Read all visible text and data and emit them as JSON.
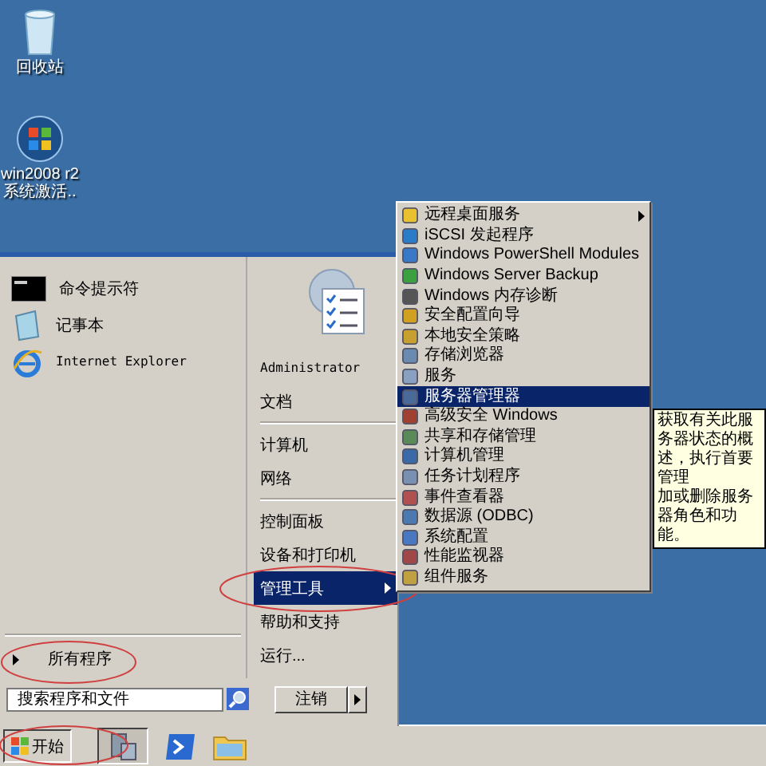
{
  "desktop_icons": [
    {
      "lines": [
        "回收站"
      ]
    },
    {
      "lines": [
        "win2008 r2",
        "系统激活.."
      ]
    }
  ],
  "start_menu": {
    "pinned": [
      {
        "label": "命令提示符"
      },
      {
        "label": "记事本"
      },
      {
        "label": "Internet Explorer"
      }
    ],
    "all_programs": "所有程序",
    "search": {
      "placeholder": "搜索程序和文件"
    },
    "user": "Administrator",
    "places": [
      {
        "label": "文档",
        "selected": false,
        "submenu": false,
        "divider_after": true
      },
      {
        "label": "计算机",
        "selected": false,
        "submenu": false,
        "divider_after": false
      },
      {
        "label": "网络",
        "selected": false,
        "submenu": false,
        "divider_after": true
      },
      {
        "label": "控制面板",
        "selected": false,
        "submenu": false,
        "divider_after": false
      },
      {
        "label": "设备和打印机",
        "selected": false,
        "submenu": false,
        "divider_after": false
      },
      {
        "label": "管理工具",
        "selected": true,
        "submenu": true,
        "divider_after": false
      },
      {
        "label": "帮助和支持",
        "selected": false,
        "submenu": false,
        "divider_after": false
      },
      {
        "label": "运行...",
        "selected": false,
        "submenu": false,
        "divider_after": false
      }
    ],
    "shutdown": "注销"
  },
  "submenu": {
    "items": [
      {
        "label": "远程桌面服务",
        "selected": false,
        "submenu": true
      },
      {
        "label": "iSCSI 发起程序",
        "selected": false,
        "submenu": false
      },
      {
        "label": "Windows PowerShell Modules",
        "selected": false,
        "submenu": false
      },
      {
        "label": "Windows Server Backup",
        "selected": false,
        "submenu": false
      },
      {
        "label": "Windows 内存诊断",
        "selected": false,
        "submenu": false
      },
      {
        "label": "安全配置向导",
        "selected": false,
        "submenu": false
      },
      {
        "label": "本地安全策略",
        "selected": false,
        "submenu": false
      },
      {
        "label": "存储浏览器",
        "selected": false,
        "submenu": false
      },
      {
        "label": "服务",
        "selected": false,
        "submenu": false
      },
      {
        "label": "服务器管理器",
        "selected": true,
        "submenu": false
      },
      {
        "label": "高级安全 Windows",
        "selected": false,
        "submenu": false
      },
      {
        "label": "共享和存储管理",
        "selected": false,
        "submenu": false
      },
      {
        "label": "计算机管理",
        "selected": false,
        "submenu": false
      },
      {
        "label": "任务计划程序",
        "selected": false,
        "submenu": false
      },
      {
        "label": "事件查看器",
        "selected": false,
        "submenu": false
      },
      {
        "label": "数据源 (ODBC)",
        "selected": false,
        "submenu": false
      },
      {
        "label": "系统配置",
        "selected": false,
        "submenu": false
      },
      {
        "label": "性能监视器",
        "selected": false,
        "submenu": false
      },
      {
        "label": "组件服务",
        "selected": false,
        "submenu": false
      }
    ]
  },
  "tooltip": {
    "lines": [
      "获取有关此服务器状态的概述，执行首要管理",
      "加或删除服务器角色和功能。"
    ]
  },
  "taskbar": {
    "start": "开始"
  }
}
